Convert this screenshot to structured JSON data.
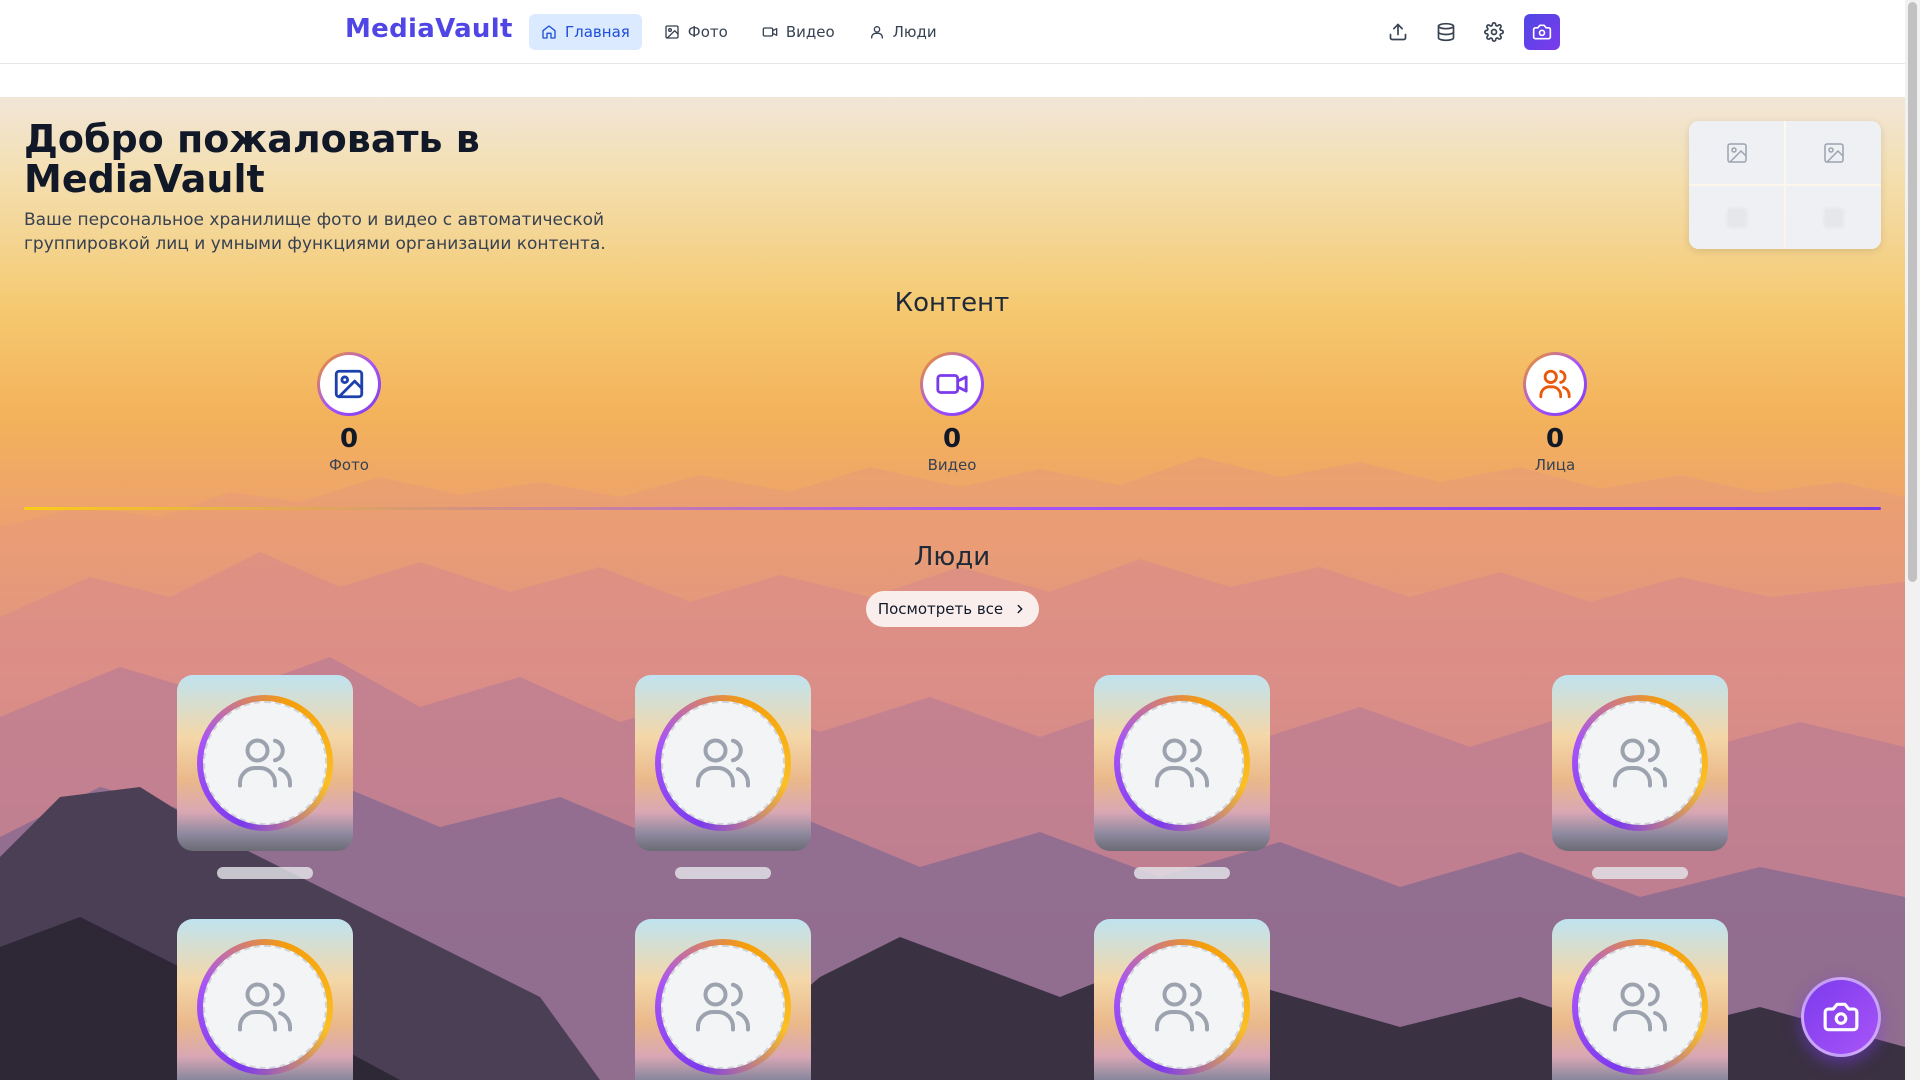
{
  "header": {
    "logo": "MediaVault",
    "nav": [
      {
        "label": "Главная",
        "icon": "home-icon",
        "active": true
      },
      {
        "label": "Фото",
        "icon": "image-icon",
        "active": false
      },
      {
        "label": "Видео",
        "icon": "video-icon",
        "active": false
      },
      {
        "label": "Люди",
        "icon": "user-icon",
        "active": false
      }
    ],
    "actions": [
      "upload-icon",
      "database-icon",
      "gear-icon",
      "camera-icon"
    ]
  },
  "welcome": {
    "title": "Добро пожаловать в MediaVault",
    "subtitle": "Ваше персональное хранилище фото и видео с автоматической группировкой лиц и умными функциями организации контента."
  },
  "content": {
    "title": "Контент",
    "stats": [
      {
        "value": "0",
        "label": "Фото",
        "icon": "image-icon",
        "color": "#1e40af"
      },
      {
        "value": "0",
        "label": "Видео",
        "icon": "video-icon",
        "color": "#7c3aed"
      },
      {
        "value": "0",
        "label": "Лица",
        "icon": "users-icon",
        "color": "#ea580c"
      }
    ]
  },
  "people": {
    "title": "Люди",
    "view_all": "Посмотреть все",
    "placeholder_count": 8
  },
  "colors": {
    "accent": "#4f46e5",
    "purple": "#7c3aed",
    "nav_active_bg": "#dbeafe"
  }
}
